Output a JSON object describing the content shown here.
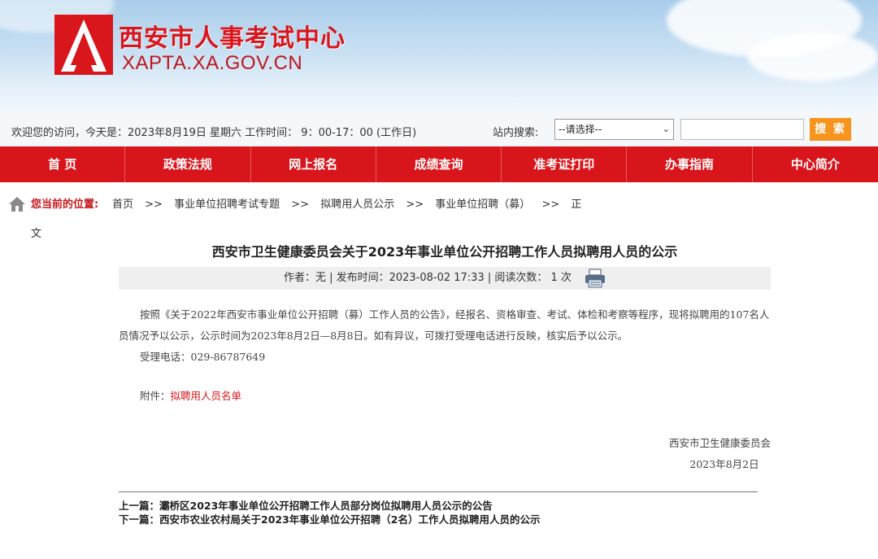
{
  "header": {
    "site_title": "西安市人事考试中心",
    "site_domain": "XAPTA.XA.GOV.CN"
  },
  "infobar": {
    "welcome": "欢迎您的访问，今天是：2023年8月19日 星期六  工作时间：  9：00-17：00 (工作日)",
    "search_label": "站内搜索:",
    "search_select": "--请选择--",
    "search_button": "搜 索"
  },
  "nav": {
    "items": [
      "首 页",
      "政策法规",
      "网上报名",
      "成绩查询",
      "准考证打印",
      "办事指南",
      "中心简介"
    ]
  },
  "breadcrumb": {
    "label": "您当前的位置:",
    "items": [
      "首页",
      ">>",
      "事业单位招聘考试专题",
      ">>",
      "拟聘用人员公示",
      ">>",
      "事业单位招聘（募）",
      ">>",
      "正"
    ],
    "wrap": "文"
  },
  "article": {
    "title": "西安市卫生健康委员会关于2023年事业单位公开招聘工作人员拟聘用人员的公示",
    "meta": "作者：无  |  发布时间：2023-08-02 17:33  |  阅读次数：  1 次",
    "paragraph": "按照《关于2022年西安市事业单位公开招聘（募）工作人员的公告》，经报名、资格审查、考试、体检和考察等程序，现将拟聘用的107名人员情况予以公示，公示时间为2023年8月2日—8月8日。如有异议，可拨打受理电话进行反映，核实后予以公示。",
    "phone": "受理电话：029-86787649",
    "attach_label": "附件：",
    "attach_link": "拟聘用人员名单",
    "sign_org": "西安市卫生健康委员会",
    "sign_date": "2023年8月2日"
  },
  "prevnext": {
    "prev": "上一篇：灞桥区2023年事业单位公开招聘工作人员部分岗位拟聘用人员公示的公告",
    "next": "下一篇：西安市农业农村局关于2023年事业单位公开招聘（2名）工作人员拟聘用人员的公示"
  },
  "colors": {
    "brand_red": "#d7151b",
    "search_orange": "#f7941d"
  }
}
